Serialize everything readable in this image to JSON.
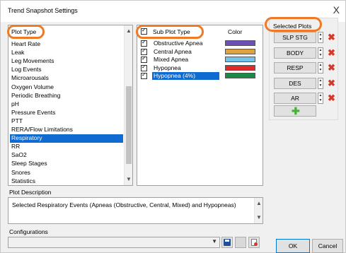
{
  "window": {
    "title": "Trend Snapshot Settings",
    "close_label": "X"
  },
  "plot_type": {
    "header": "Plot Type",
    "items": [
      "Heart Rate",
      "Leak",
      "Leg Movements",
      "Log Events",
      "Microarousals",
      "Oxygen Volume",
      "Periodic Breathing",
      "pH",
      "Pressure Events",
      "PTT",
      "RERA/Flow Limitations",
      "Respiratory",
      "RR",
      "SaO2",
      "Sleep Stages",
      "Snores",
      "Statistics"
    ],
    "selected": "Respiratory"
  },
  "sub_plot": {
    "header": "Sub Plot Type",
    "color_header": "Color",
    "items": [
      {
        "label": "Obstructive Apnea",
        "color": "#6a4fb8",
        "checked": true
      },
      {
        "label": "Central Apnea",
        "color": "#e0a23a",
        "checked": true
      },
      {
        "label": "Mixed Apnea",
        "color": "#6fc4ea",
        "checked": true
      },
      {
        "label": "Hypopnea",
        "color": "#e02a2a",
        "checked": true
      },
      {
        "label": "Hypopnea (4%)",
        "color": "#1a8a46",
        "checked": true,
        "selected": true
      }
    ]
  },
  "selected_plots": {
    "header": "Selected Plots",
    "items": [
      "SLP STG",
      "BODY",
      "RESP",
      "DES",
      "AR"
    ],
    "add_icon": "plus-icon",
    "delete_icon": "delete-x-icon"
  },
  "description": {
    "label": "Plot Description",
    "text": "Selected Respiratory Events (Apneas (Obstructive, Central, Mixed) and Hypopneas)"
  },
  "configurations": {
    "label": "Configurations",
    "value": ""
  },
  "buttons": {
    "ok": "OK",
    "cancel": "Cancel"
  },
  "accent_colors": {
    "selection": "#0f6ad1",
    "highlight": "#ee7a28",
    "delete": "#d43a2a",
    "add": "#46b335"
  }
}
